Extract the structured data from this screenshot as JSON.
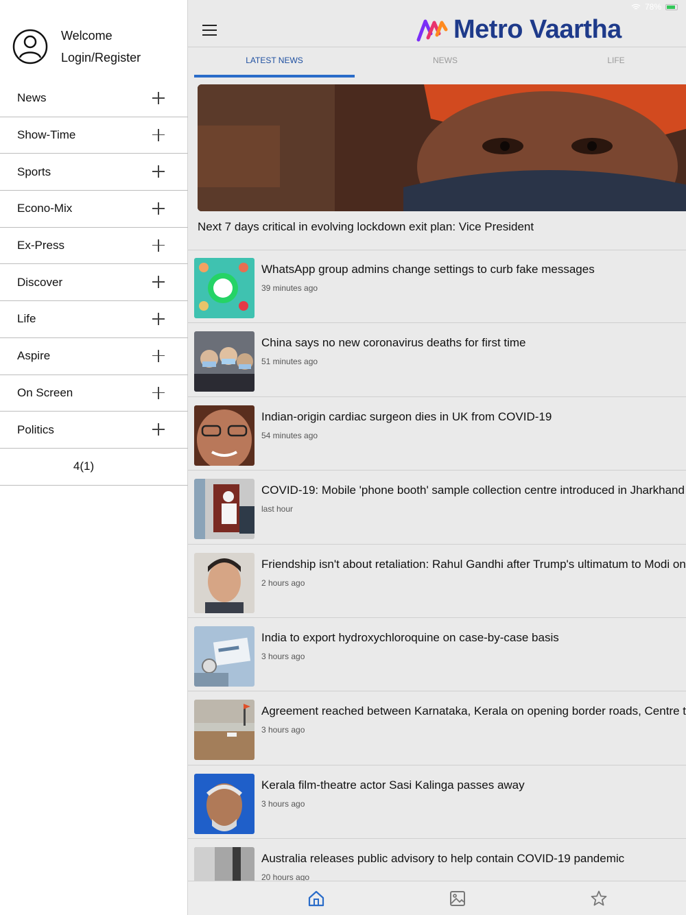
{
  "status": {
    "battery": "78%"
  },
  "sidebar": {
    "welcome": "Welcome",
    "login": "Login/Register",
    "items": [
      {
        "label": "News"
      },
      {
        "label": "Show-Time"
      },
      {
        "label": "Sports"
      },
      {
        "label": "Econo-Mix"
      },
      {
        "label": "Ex-Press"
      },
      {
        "label": "Discover"
      },
      {
        "label": "Life"
      },
      {
        "label": "Aspire"
      },
      {
        "label": "On Screen"
      },
      {
        "label": "Politics"
      }
    ],
    "counter": "4(1)"
  },
  "header": {
    "brand": "Metro Vaartha",
    "menu_icon": "hamburger-icon"
  },
  "tabs": [
    {
      "label": "LATEST NEWS",
      "active": true
    },
    {
      "label": "NEWS",
      "active": false
    },
    {
      "label": "LIFE",
      "active": false
    }
  ],
  "hero": {
    "caption": "Next 7 days critical in evolving lockdown exit plan: Vice President"
  },
  "articles": [
    {
      "title": "WhatsApp group admins change settings to curb fake messages",
      "time": "39 minutes ago"
    },
    {
      "title": "China says no new coronavirus deaths for first time",
      "time": "51 minutes ago"
    },
    {
      "title": "Indian-origin cardiac surgeon dies in UK from COVID-19",
      "time": "54 minutes ago"
    },
    {
      "title": "COVID-19: Mobile 'phone booth' sample collection centre introduced in Jharkhand",
      "time": "last hour"
    },
    {
      "title": "Friendship isn't about retaliation: Rahul Gandhi after Trump's ultimatum to Modi on",
      "time": "2 hours ago"
    },
    {
      "title": "India to export hydroxychloroquine on case-by-case basis",
      "time": "3 hours ago"
    },
    {
      "title": "Agreement reached between Karnataka, Kerala on opening border roads, Centre te",
      "time": "3 hours ago"
    },
    {
      "title": "Kerala film-theatre actor Sasi Kalinga passes away",
      "time": "3 hours ago"
    },
    {
      "title": "Australia releases public advisory to help contain COVID-19 pandemic",
      "time": "20 hours ago"
    }
  ],
  "bottom_nav": [
    {
      "icon": "home-icon",
      "active": true
    },
    {
      "icon": "gallery-icon",
      "active": false
    },
    {
      "icon": "star-icon",
      "active": false
    }
  ],
  "colors": {
    "accent": "#2a6cc9",
    "brand": "#1e3a8a"
  }
}
